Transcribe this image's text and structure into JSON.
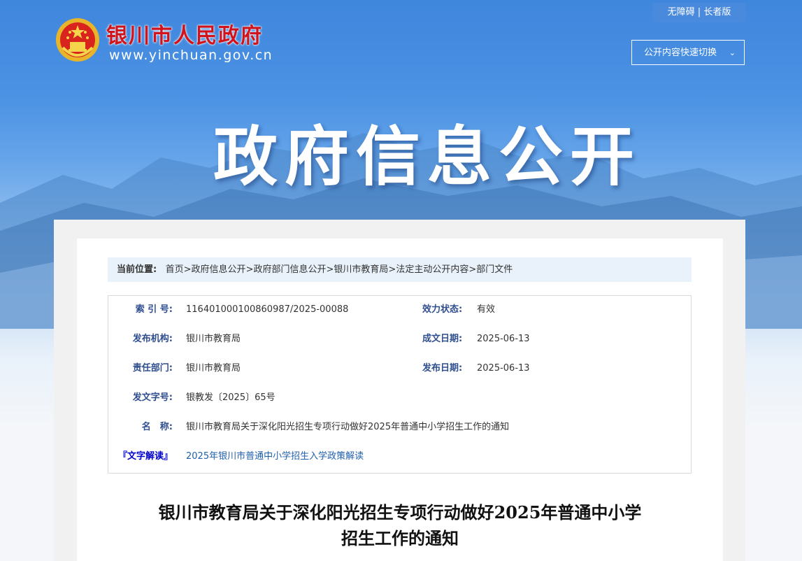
{
  "header": {
    "site_name": "银川市人民政府",
    "site_url": "www.yinchuan.gov.cn",
    "accessibility": "无障碍",
    "separator": "|",
    "elder_mode": "长者版",
    "quick_switch": "公开内容快速切换",
    "hero_title": "政府信息公开"
  },
  "breadcrumb": {
    "label": "当前位置:",
    "items": [
      "首页",
      "政府信息公开",
      "政府部门信息公开",
      "银川市教育局",
      "法定主动公开内容",
      "部门文件"
    ],
    "sep": ">"
  },
  "meta": {
    "index_key": "索 引 号:",
    "index_value": "116401000100860987/2025-00088",
    "status_key": "效力状态:",
    "status_value": "有效",
    "org_key": "发布机构:",
    "org_value": "银川市教育局",
    "written_key": "成文日期:",
    "written_value": "2025-06-13",
    "dept_key": "责任部门:",
    "dept_value": "银川市教育局",
    "publish_key": "发布日期:",
    "publish_value": "2025-06-13",
    "doc_no_key": "发文字号:",
    "doc_no_value": "银教发〔2025〕65号",
    "name_key": "名　称:",
    "name_value": "银川市教育局关于深化阳光招生专项行动做好2025年普通中小学招生工作的通知",
    "interpret_key": "『文字解读』",
    "interpret_value": "2025年银川市普通中小学招生入学政策解读"
  },
  "article": {
    "title_line1": "银川市教育局关于深化阳光招生专项行动做好2025年普通中小学",
    "title_line2": "招生工作的通知"
  }
}
